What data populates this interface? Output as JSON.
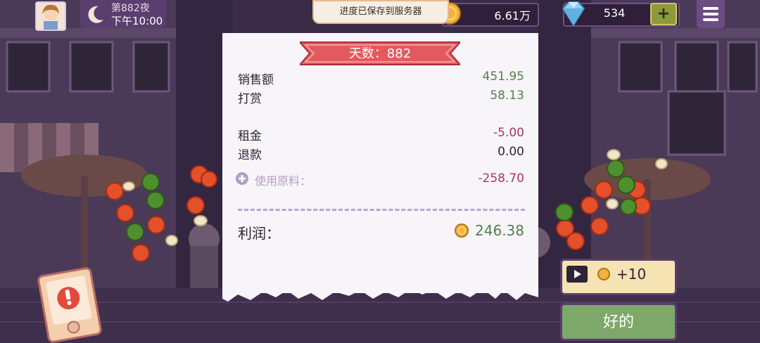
{
  "header": {
    "night_label": "第882夜",
    "time_label": "下午10:00",
    "coins": "6.61万",
    "gems": "534",
    "add_label": "+",
    "save_toast": "进度已保存到服务器"
  },
  "receipt": {
    "day_title": "天数：882",
    "sales_label": "销售额",
    "sales_value": "451.95",
    "tips_label": "打赏",
    "tips_value": "58.13",
    "rent_label": "租金",
    "rent_value": "-5.00",
    "refund_label": "退款",
    "refund_value": "0.00",
    "ingredients_label": "使用原料：",
    "ingredients_value": "-258.70",
    "profit_label": "利润：",
    "profit_value": "246.38"
  },
  "actions": {
    "ad_reward_label": "+10",
    "ok_label": "好的"
  },
  "colors": {
    "positive": "#55804a",
    "negative": "#b0355a",
    "ribbon": "#e35a5e",
    "ok_button": "#7ea86a",
    "panel_purple": "#5a3e6e"
  }
}
